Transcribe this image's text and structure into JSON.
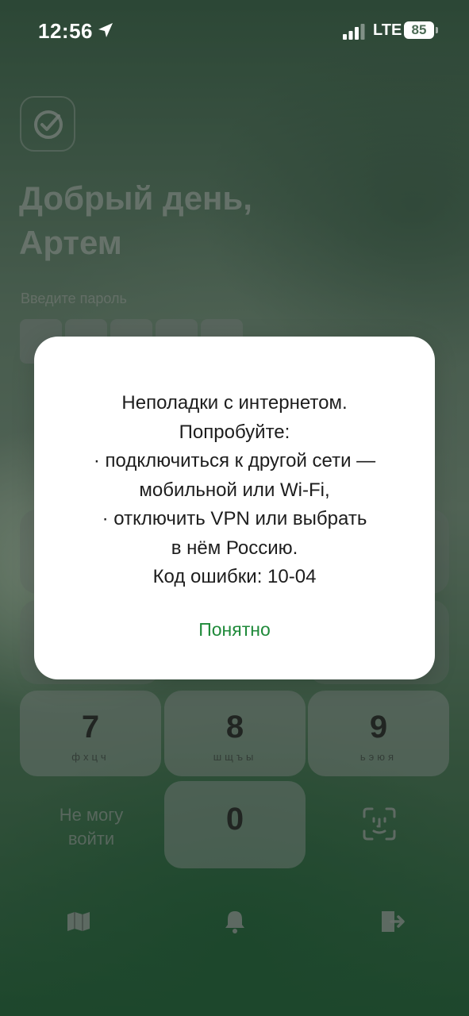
{
  "status_bar": {
    "time": "12:56",
    "network": "LTE",
    "battery": "85"
  },
  "app": {
    "greeting": "Добрый день,\nАртем",
    "password_label": "Введите пароль",
    "keypad": [
      {
        "digit": "7",
        "letters": "фхцч"
      },
      {
        "digit": "8",
        "letters": "шщъы"
      },
      {
        "digit": "9",
        "letters": "ьэюя"
      },
      {
        "digit": "0",
        "letters": ""
      }
    ],
    "cant_login": "Не могу\nвойти",
    "bottom_icons": [
      "map-icon",
      "bell-icon",
      "exit-icon"
    ]
  },
  "dialog": {
    "message": "Неполадки с интернетом.\nПопробуйте:\n· подключиться к другой сети —\nмобильной или Wi-Fi,\n· отключить VPN или выбрать\nв нём Россию.\nКод ошибки: 10-04",
    "ok_label": "Понятно"
  },
  "colors": {
    "accent_green": "#1f8a3a"
  }
}
